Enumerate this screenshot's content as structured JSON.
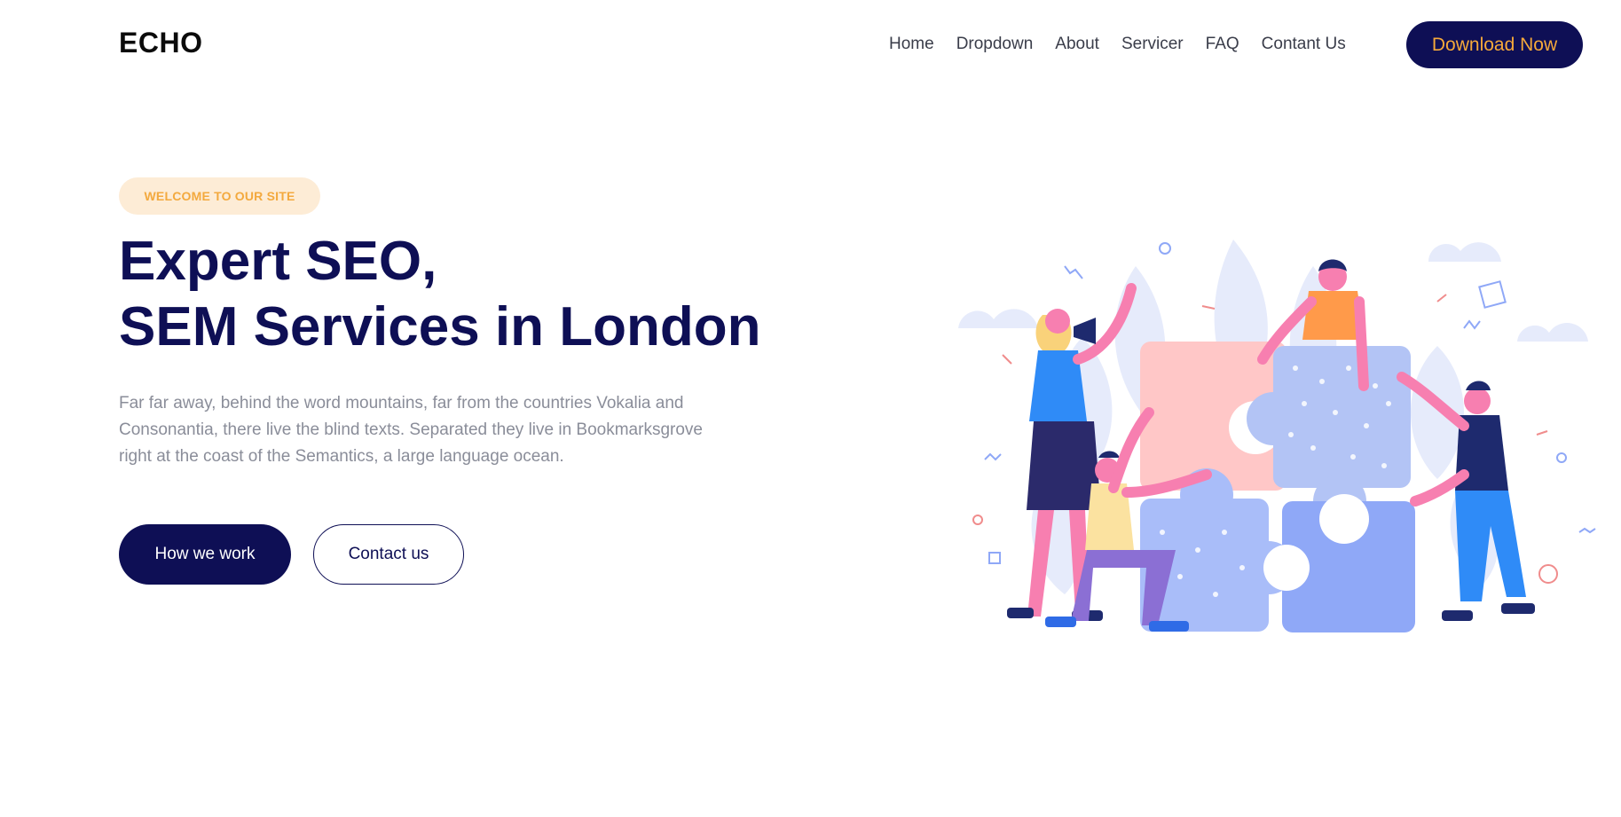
{
  "brand": {
    "logo": "ECHO"
  },
  "nav": {
    "items": [
      "Home",
      "Dropdown",
      "About",
      "Servicer",
      "FAQ",
      "Contant Us"
    ],
    "cta": "Download Now"
  },
  "hero": {
    "badge": "WELCOME TO OUR SITE",
    "title_line1": "Expert SEO,",
    "title_line2": "SEM Services in London",
    "description": "Far far away, behind the word mountains, far from the countries Vokalia and Consonantia, there live the blind texts. Separated they live in Bookmarksgrove right at the coast of the Semantics, a large language ocean.",
    "primary_button": "How we work",
    "secondary_button": "Contact us"
  },
  "colors": {
    "navy": "#0e0f55",
    "accent_orange": "#f6a93a",
    "badge_bg": "#fdecd6",
    "puzzle_pink": "#ffc7c7",
    "puzzle_lavender": "#b3c4f5",
    "puzzle_blue": "#8fa8f7"
  },
  "illustration": {
    "icon": "team-puzzle-illustration"
  }
}
